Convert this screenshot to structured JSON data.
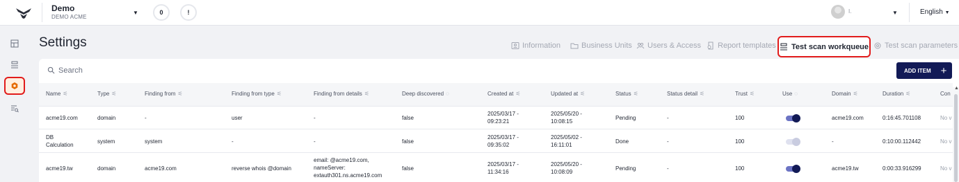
{
  "topbar": {
    "org_name": "Demo",
    "org_sub": "DEMO ACME",
    "notifications_count": "0",
    "alert_symbol": "!",
    "user_name": "I.",
    "language": "English"
  },
  "sidebar": {
    "items": [
      {
        "icon": "dashboard-icon"
      },
      {
        "icon": "scan-icon"
      },
      {
        "icon": "settings-icon",
        "active": true
      },
      {
        "icon": "filter-search-icon"
      }
    ]
  },
  "page": {
    "title": "Settings"
  },
  "tabs": [
    {
      "label": "Information",
      "icon": "info-icon"
    },
    {
      "label": "Business Units",
      "icon": "folder-icon"
    },
    {
      "label": "Users & Access",
      "icon": "users-icon"
    },
    {
      "label": "Report templates",
      "icon": "report-icon"
    },
    {
      "label": "Test scan workqueue",
      "icon": "scan-queue-icon",
      "active": true
    },
    {
      "label": "Test scan parameters",
      "icon": "gear-icon"
    }
  ],
  "search": {
    "placeholder": "Search"
  },
  "add_item_label": "ADD ITEM",
  "table": {
    "columns": [
      "Name",
      "Type",
      "Finding from",
      "Finding from type",
      "Finding from details",
      "Deep discovered",
      "Created at",
      "Updated at",
      "Status",
      "Status detail",
      "Trust",
      "Use",
      "Domain",
      "Duration",
      "Con"
    ],
    "rows": [
      {
        "name": [
          "acme19.com"
        ],
        "type": "domain",
        "finding_from": "-",
        "finding_from_type": "user",
        "finding_from_details": [
          "-"
        ],
        "deep_discovered": "false",
        "created_at": [
          "2025/03/17 -",
          "09:23:21"
        ],
        "updated_at": [
          "2025/05/20 -",
          "10:08:15"
        ],
        "status": "Pending",
        "status_detail": "-",
        "trust": "100",
        "use": true,
        "domain": "acme19.com",
        "duration": "0:16:45.701108",
        "con": "No v"
      },
      {
        "name": [
          "DB",
          "Calculation"
        ],
        "type": "system",
        "finding_from": "system",
        "finding_from_type": "-",
        "finding_from_details": [
          "-"
        ],
        "deep_discovered": "false",
        "created_at": [
          "2025/03/17 -",
          "09:35:02"
        ],
        "updated_at": [
          "2025/05/02 -",
          "16:11:01"
        ],
        "status": "Done",
        "status_detail": "-",
        "trust": "100",
        "use": false,
        "domain": "-",
        "duration": "0:10:00.112442",
        "con": "No v"
      },
      {
        "name": [
          "acme19.tw"
        ],
        "type": "domain",
        "finding_from": "acme19.com",
        "finding_from_type": "reverse whois @domain",
        "finding_from_details": [
          "email: @acme19.com,",
          "nameServer:",
          "extauth301.ns.acme19.com"
        ],
        "deep_discovered": "false",
        "created_at": [
          "2025/03/17 -",
          "11:34:16"
        ],
        "updated_at": [
          "2025/05/20 -",
          "10:08:09"
        ],
        "status": "Pending",
        "status_detail": "-",
        "trust": "100",
        "use": true,
        "domain": "acme19.tw",
        "duration": "0:00:33.916299",
        "con": "No v"
      }
    ]
  },
  "colors": {
    "accent_navy": "#121a56",
    "highlight_red": "#e11b1b",
    "active_orange": "#e56a00"
  }
}
